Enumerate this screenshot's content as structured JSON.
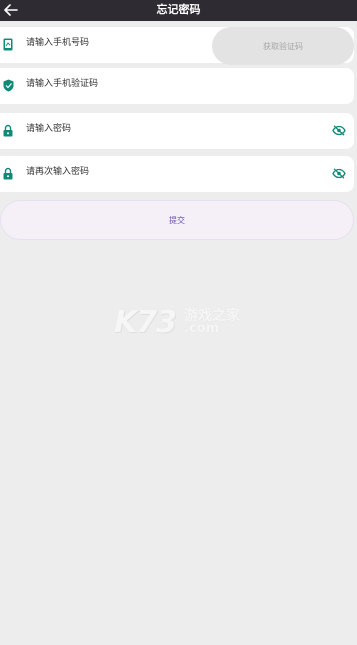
{
  "header": {
    "title": "忘记密码",
    "back_icon": "arrow-left-icon"
  },
  "form": {
    "phone": {
      "placeholder": "请输入手机号码",
      "icon": "phone-icon"
    },
    "get_code_button": "获取验证码",
    "sms_code": {
      "placeholder": "请输入手机验证码",
      "icon": "shield-icon"
    },
    "password": {
      "placeholder": "请输入密码",
      "icon": "lock-icon",
      "toggle_icon": "eye-off-icon"
    },
    "password_confirm": {
      "placeholder": "请再次输入密码",
      "icon": "lock-icon",
      "toggle_icon": "eye-off-icon"
    },
    "submit_label": "提交"
  },
  "watermark": {
    "logo": "K73",
    "cn_text": "游戏之家",
    "domain": ".com"
  },
  "colors": {
    "header_bg": "#2e2b33",
    "background": "#ededed",
    "icon_teal": "#0f8a76",
    "submit_text": "#6c4fa3"
  }
}
